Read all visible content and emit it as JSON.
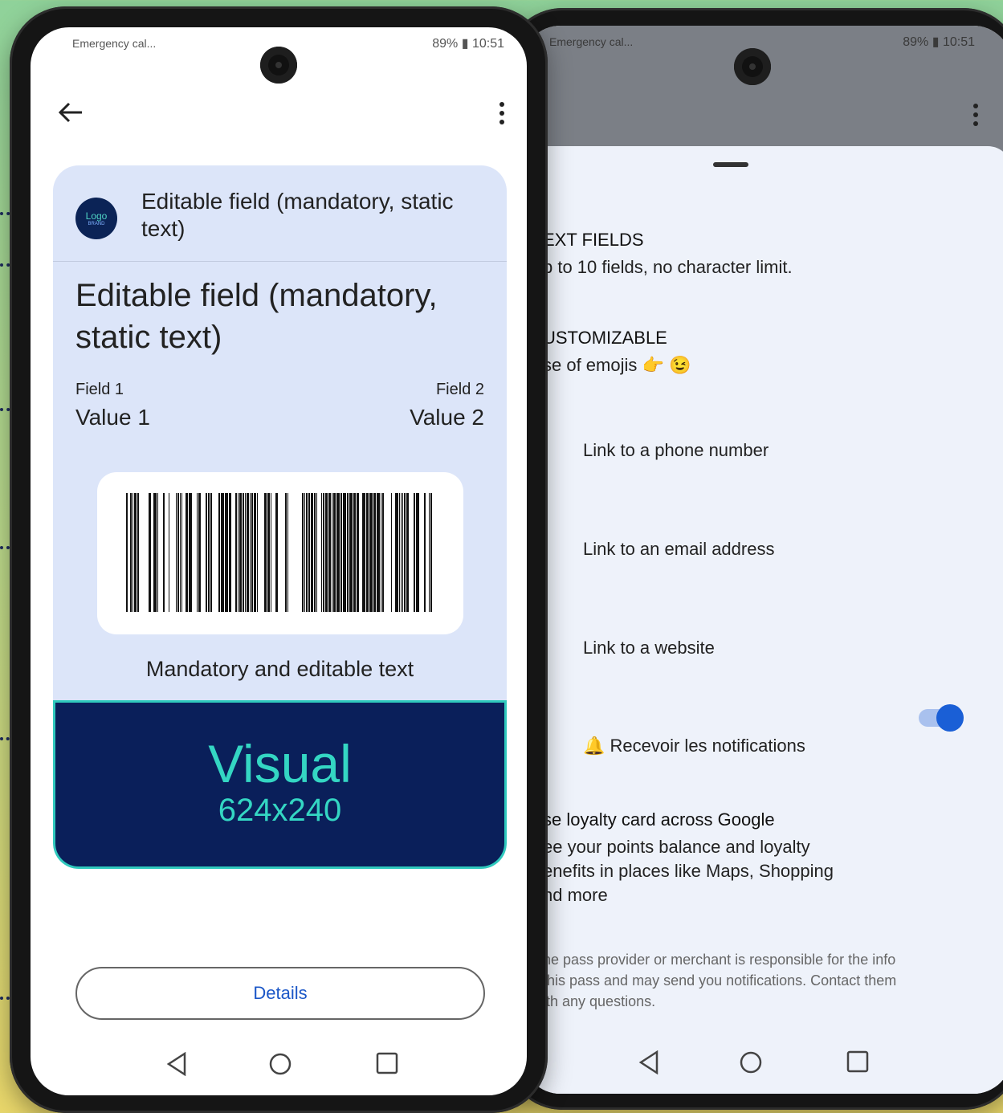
{
  "left_phone": {
    "status": {
      "left": "Emergency cal...",
      "right": "89% ▮ 10:51"
    },
    "card": {
      "logo_text": "Logo",
      "logo_sub": "BRAND",
      "header_text": "Editable field (mandatory, static text)",
      "title": "Editable field (mandatory, static text)",
      "field1_label": "Field 1",
      "field1_value": "Value 1",
      "field2_label": "Field 2",
      "field2_value": "Value 2",
      "barcode_text": "Mandatory and editable text",
      "visual_title": "Visual",
      "visual_size": "624x240"
    },
    "details_button": "Details"
  },
  "right_phone": {
    "status": {
      "left": "Emergency cal...",
      "right": "89% ▮ 10:51"
    },
    "text_fields_title": "EXT FIELDS",
    "text_fields_body": "p to 10 fields, no character limit.",
    "customizable_title": "USTOMIZABLE",
    "customizable_body": "se of emojis 👉 😉",
    "links": [
      {
        "label": "Link to a phone number"
      },
      {
        "label": "Link to an email address"
      },
      {
        "label": "Link to a website"
      },
      {
        "label": "🔔 Recevoir les notifications"
      }
    ],
    "loyalty_title": "se loyalty card across Google",
    "loyalty_body_1": "ee your points balance and loyalty",
    "loyalty_body_2": "enefits in places like Maps, Shopping",
    "loyalty_body_3": "nd more",
    "loyalty_toggle_on": true,
    "disclaimer_1": "he pass provider or merchant is responsible for the info",
    "disclaimer_2": "this pass and may send you notifications. Contact them",
    "disclaimer_3": "ith any questions."
  }
}
